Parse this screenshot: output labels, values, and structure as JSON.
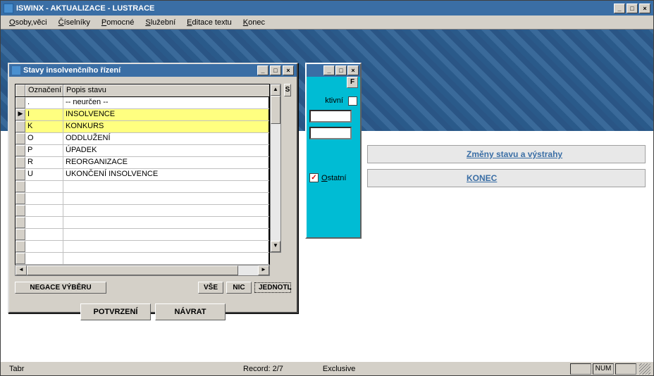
{
  "window": {
    "title": "ISWINX - AKTUALIZACE - LUSTRACE"
  },
  "menu": {
    "items": [
      {
        "pre": "",
        "ul": "O",
        "post": "soby,věci"
      },
      {
        "pre": "",
        "ul": "Č",
        "post": "íselníky"
      },
      {
        "pre": "",
        "ul": "P",
        "post": "omocné"
      },
      {
        "pre": "",
        "ul": "S",
        "post": "lužební"
      },
      {
        "pre": "",
        "ul": "E",
        "post": "ditace textu"
      },
      {
        "pre": "",
        "ul": "K",
        "post": "onec"
      }
    ]
  },
  "dialog": {
    "title": "Stavy insolvenčního řízení",
    "col1": "Označení",
    "col2": "Popis stavu",
    "rows": [
      {
        "code": ".",
        "desc": "-- neurčen --",
        "sel": false,
        "ptr": false
      },
      {
        "code": "I",
        "desc": "INSOLVENCE",
        "sel": true,
        "ptr": true
      },
      {
        "code": "K",
        "desc": "KONKURS",
        "sel": true,
        "ptr": false
      },
      {
        "code": "O",
        "desc": "ODDLUŽENÍ",
        "sel": false,
        "ptr": false
      },
      {
        "code": "P",
        "desc": "ÚPADEK",
        "sel": false,
        "ptr": false
      },
      {
        "code": "R",
        "desc": "REORGANIZACE",
        "sel": false,
        "ptr": false
      },
      {
        "code": "U",
        "desc": "UKONČENÍ INSOLVENCE",
        "sel": false,
        "ptr": false
      }
    ],
    "empty_rows": 7,
    "buttons": {
      "negace": "NEGACE VÝBĚRU",
      "vse": "VŠE",
      "nic": "NIC",
      "jednotl": "JEDNOTL",
      "potvrzeni": "POTVRZENÍ",
      "navrat": "NÁVRAT",
      "s": "S"
    }
  },
  "cyan": {
    "f": "F",
    "aktivni": "ktivní",
    "ostatni_ul": "O",
    "ostatni_rest": "statní"
  },
  "side": {
    "link1": "Změny stavu a výstrahy",
    "link2": "KONEC"
  },
  "status": {
    "tabr": "Tabr",
    "record": "Record: 2/7",
    "exclusive": "Exclusive",
    "num": "NUM"
  }
}
